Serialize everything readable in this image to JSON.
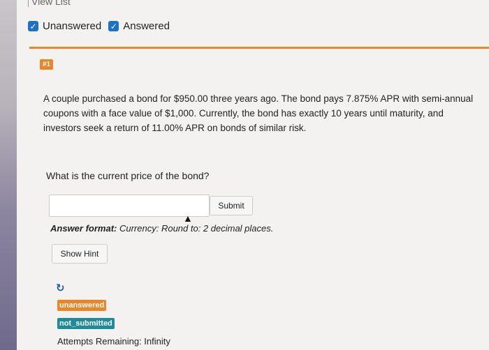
{
  "header": {
    "view_list": "View List"
  },
  "filters": [
    {
      "label": "Unanswered",
      "checked": true
    },
    {
      "label": "Answered",
      "checked": true
    }
  ],
  "question": {
    "number": "#1",
    "text": "A couple purchased a bond for $950.00 three years ago. The bond pays 7.875% APR with semi-annual coupons with a face value of $1,000. Currently, the bond has exactly 10 years until maturity, and investors seek a return of 11.00% APR on bonds of similar risk.",
    "prompt": "What is the current price of the bond?",
    "answer_value": "",
    "submit_label": "Submit",
    "format_label": "Answer format:",
    "format_text": "Currency: Round to: 2 decimal places.",
    "hint_label": "Show Hint"
  },
  "status": {
    "answer_status": "unanswered",
    "submit_status": "not_submitted",
    "attempts": "Attempts Remaining: Infinity"
  },
  "colors": {
    "accent_orange": "#e8862a",
    "checkbox_blue": "#1a73c9",
    "teal_badge": "#1f8a9a"
  }
}
